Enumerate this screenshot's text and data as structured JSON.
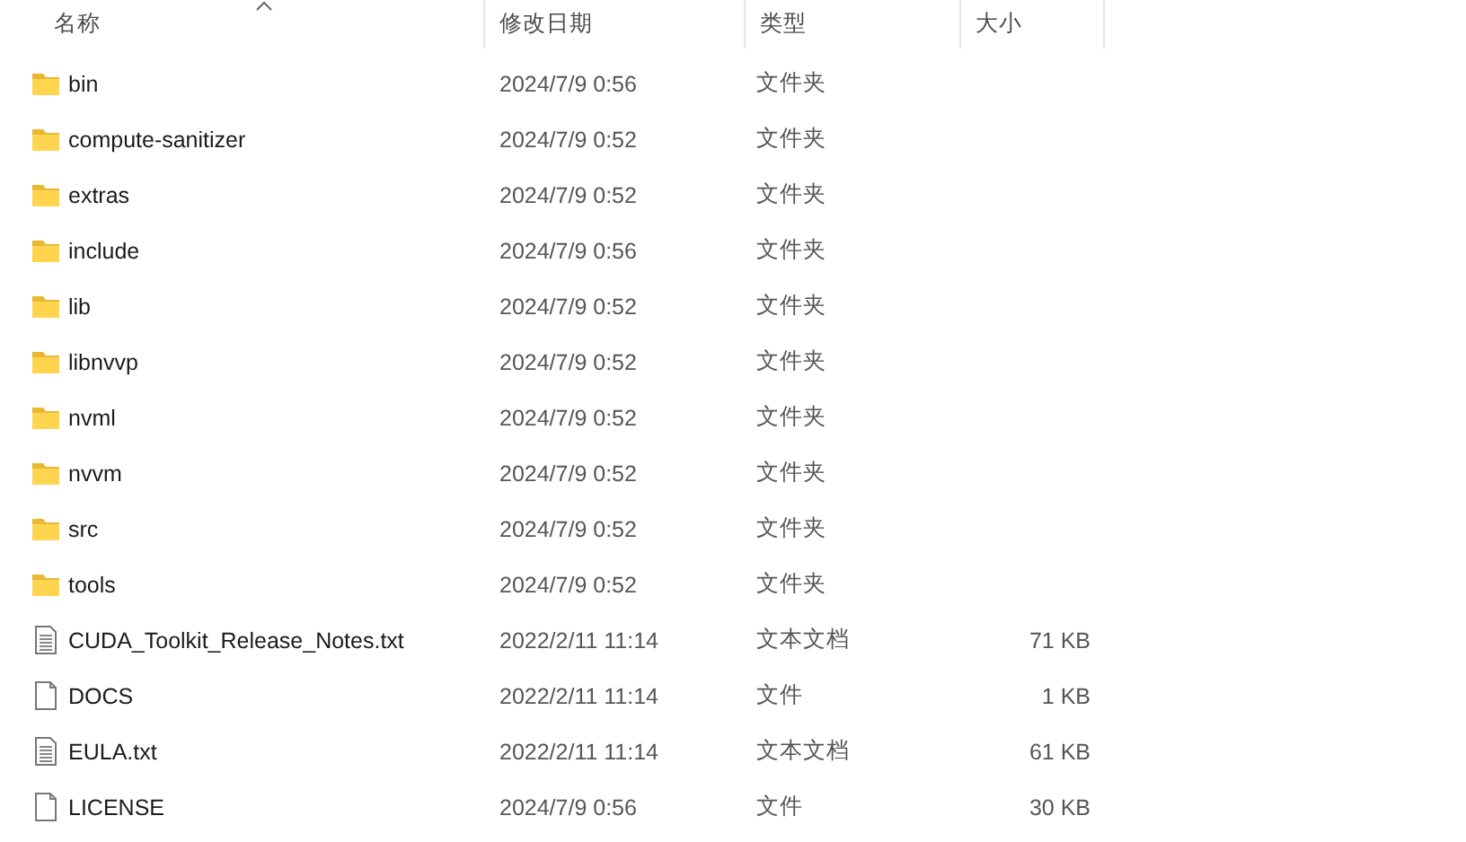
{
  "columns": [
    {
      "label": "名称",
      "sorted": true
    },
    {
      "label": "修改日期",
      "sorted": false
    },
    {
      "label": "类型",
      "sorted": false
    },
    {
      "label": "大小",
      "sorted": false
    }
  ],
  "files": [
    {
      "kind": "folder",
      "name": "bin",
      "modified": "2024/7/9 0:56",
      "type": "文件夹"
    },
    {
      "kind": "folder",
      "name": "compute-sanitizer",
      "modified": "2024/7/9 0:52",
      "type": "文件夹"
    },
    {
      "kind": "folder",
      "name": "extras",
      "modified": "2024/7/9 0:52",
      "type": "文件夹"
    },
    {
      "kind": "folder",
      "name": "include",
      "modified": "2024/7/9 0:56",
      "type": "文件夹"
    },
    {
      "kind": "folder",
      "name": "lib",
      "modified": "2024/7/9 0:52",
      "type": "文件夹"
    },
    {
      "kind": "folder",
      "name": "libnvvp",
      "modified": "2024/7/9 0:52",
      "type": "文件夹"
    },
    {
      "kind": "folder",
      "name": "nvml",
      "modified": "2024/7/9 0:52",
      "type": "文件夹"
    },
    {
      "kind": "folder",
      "name": "nvvm",
      "modified": "2024/7/9 0:52",
      "type": "文件夹"
    },
    {
      "kind": "folder",
      "name": "src",
      "modified": "2024/7/9 0:52",
      "type": "文件夹"
    },
    {
      "kind": "folder",
      "name": "tools",
      "modified": "2024/7/9 0:52",
      "type": "文件夹"
    },
    {
      "kind": "text",
      "name": "CUDA_Toolkit_Release_Notes.txt",
      "modified": "2022/2/11 11:14",
      "type": "文本文档",
      "size": "71 KB"
    },
    {
      "kind": "file",
      "name": "DOCS",
      "modified": "2022/2/11 11:14",
      "type": "文件",
      "size": "1 KB"
    },
    {
      "kind": "text",
      "name": "EULA.txt",
      "modified": "2022/2/11 11:14",
      "type": "文本文档",
      "size": "61 KB"
    },
    {
      "kind": "file",
      "name": "LICENSE",
      "modified": "2024/7/9 0:56",
      "type": "文件",
      "size": "30 KB"
    }
  ]
}
